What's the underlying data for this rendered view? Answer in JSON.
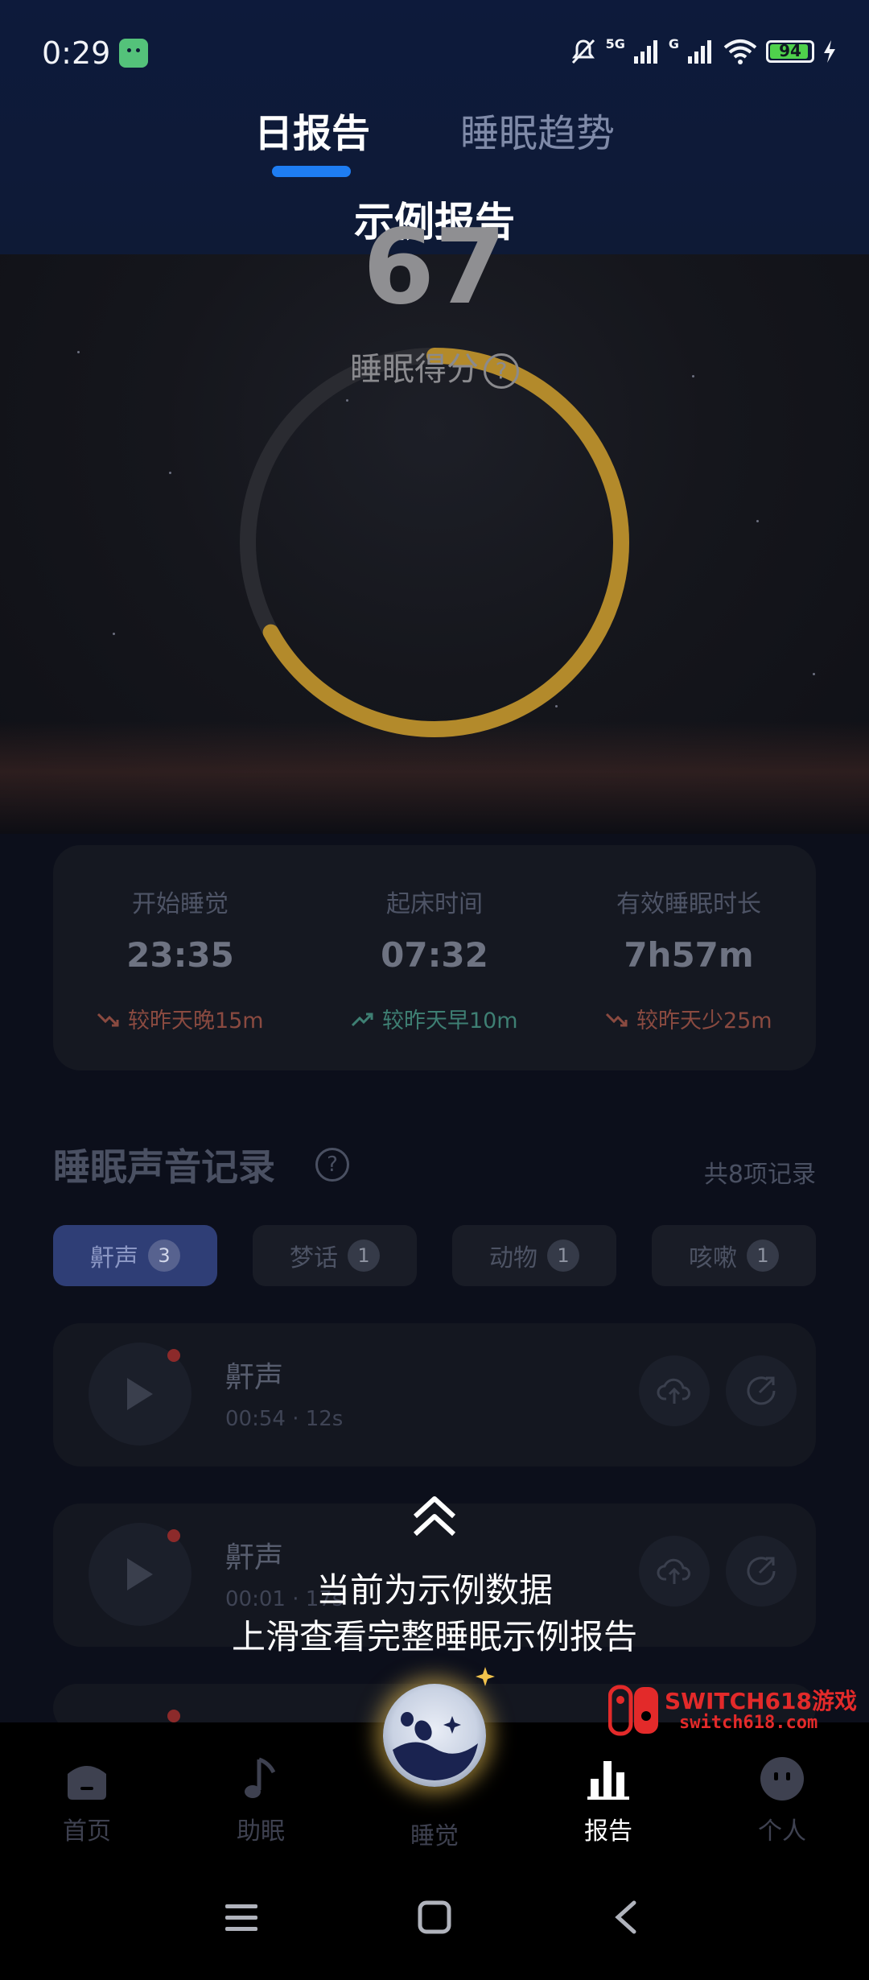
{
  "status_bar": {
    "time": "0:29",
    "network": "5G",
    "network2": "G",
    "battery": "94",
    "battery_level": 0.94
  },
  "header": {
    "tabs": [
      {
        "label": "日报告",
        "active": true
      },
      {
        "label": "睡眠趋势",
        "active": false
      }
    ],
    "subtitle": "示例报告"
  },
  "score": {
    "value": "67",
    "progress": 0.67,
    "label": "睡眠得分",
    "help_icon": "?",
    "ring_color": "#b38a2b"
  },
  "stats": [
    {
      "title": "开始睡觉",
      "value": "23:35",
      "delta": "较昨天晚15m",
      "trend": "down"
    },
    {
      "title": "起床时间",
      "value": "07:32",
      "delta": "较昨天早10m",
      "trend": "up"
    },
    {
      "title": "有效睡眠时长",
      "value": "7h57m",
      "delta": "较昨天少25m",
      "trend": "down"
    }
  ],
  "records": {
    "title": "睡眠声音记录",
    "help_icon": "?",
    "count_label": "共8项记录",
    "chips": [
      {
        "label": "鼾声",
        "count": "3",
        "active": true
      },
      {
        "label": "梦话",
        "count": "1",
        "active": false
      },
      {
        "label": "动物",
        "count": "1",
        "active": false
      },
      {
        "label": "咳嗽",
        "count": "1",
        "active": false
      }
    ],
    "items": [
      {
        "name": "鼾声",
        "meta": "00:54 · 12s"
      },
      {
        "name": "鼾声",
        "meta": "00:01 · 17s"
      }
    ]
  },
  "overlay": {
    "line1": "当前为示例数据",
    "line2": "上滑查看完整睡眠示例报告"
  },
  "bottom_nav": [
    {
      "label": "首页",
      "icon": "home-icon",
      "active": false
    },
    {
      "label": "助眠",
      "icon": "music-note-icon",
      "active": false
    },
    {
      "label": "睡觉",
      "icon": "panda-moon-icon",
      "active": false
    },
    {
      "label": "报告",
      "icon": "bar-chart-icon",
      "active": true
    },
    {
      "label": "个人",
      "icon": "profile-face-icon",
      "active": false
    }
  ],
  "watermark": {
    "line1": "SWITCH618游戏",
    "line2": "switch618.com"
  },
  "colors": {
    "accent": "#1e7df2",
    "header_bg": "#0d1a3b",
    "score_ring": "#b38a2b",
    "delta_late": "#8a4a40",
    "delta_early": "#3e7f73",
    "chip_active": "#2f3e76"
  }
}
